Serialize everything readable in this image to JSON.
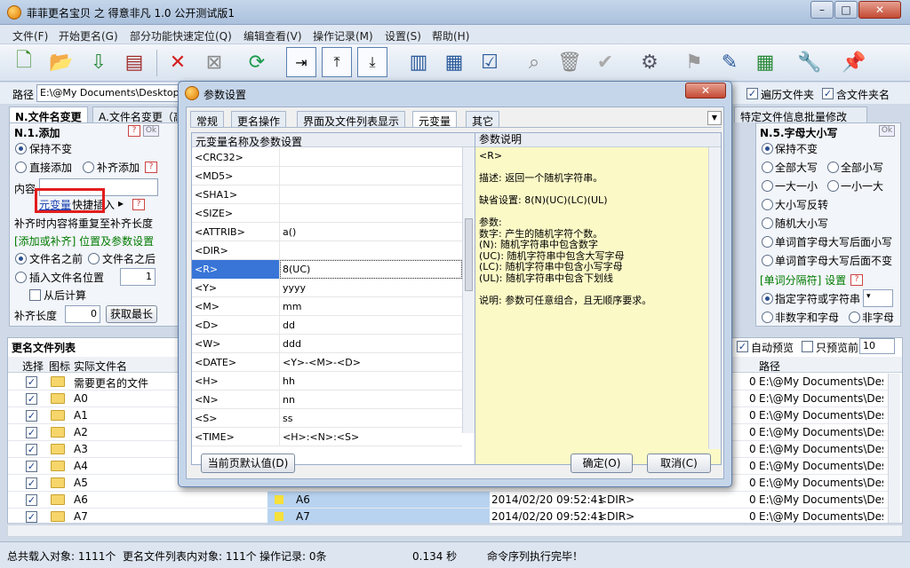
{
  "app": {
    "title": "菲菲更名宝贝 之 得意非凡 1.0 公开测试版1"
  },
  "menu": [
    "文件(F)",
    "开始更名(G)",
    "部分功能快速定位(Q)",
    "编辑查看(V)",
    "操作记录(M)",
    "设置(S)",
    "帮助(H)"
  ],
  "pathbar": {
    "label": "路径",
    "value": "E:\\@My Documents\\Desktop\\",
    "traverse_folders": "遍历文件夹",
    "include_folder_names": "含文件夹名"
  },
  "left_panel": {
    "tabs": [
      "N.文件名变更",
      "A.文件名变更（高"
    ],
    "section_title": "N.1.添加",
    "keep": "保持不变",
    "direct_add": "直接添加",
    "pad_add": "补齐添加",
    "content_label": "内容",
    "meta_link": "元变量",
    "quick_insert": "快捷插入",
    "pad_repeat_note": "补齐时内容将重复至补齐长度",
    "position_header": "[添加或补齐] 位置及参数设置",
    "before_name": "文件名之前",
    "after_name": "文件名之后",
    "insert_pos": "插入文件名位置",
    "insert_value": "1",
    "from_end": "从后计算",
    "pad_len_label": "补齐长度",
    "pad_len_value": "0",
    "get_max": "获取最长"
  },
  "right_panel": {
    "tab": "特定文件信息批量修改",
    "section_title": "N.5.字母大小写",
    "options": [
      "保持不变",
      "全部大写",
      "全部小写",
      "一大一小",
      "一小一大",
      "大小写反转",
      "随机大小写",
      "单词首字母大写后面小写",
      "单词首字母大写后面不变"
    ],
    "word_sep_header": "[单词分隔符] 设置",
    "specified": "指定字符或字符串",
    "non_digit": "非数字和字母",
    "non_letter": "非字母",
    "auto_preview": "自动预览",
    "preview_only": "只预览前",
    "preview_count": "10"
  },
  "file_list": {
    "title": "更名文件列表",
    "columns": {
      "select": "选择",
      "icon": "图标",
      "name": "实际文件名",
      "path": "路径"
    },
    "rows": [
      {
        "name": "需要更名的文件",
        "new": "",
        "time": "",
        "type": "",
        "size": "0",
        "path": "E:\\@My Documents\\Desktop"
      },
      {
        "name": "A0",
        "new": "",
        "time": "",
        "type": "",
        "size": "0",
        "path": "E:\\@My Documents\\Desktop"
      },
      {
        "name": "A1",
        "new": "",
        "time": "",
        "type": "",
        "size": "0",
        "path": "E:\\@My Documents\\Desktop"
      },
      {
        "name": "A2",
        "new": "",
        "time": "",
        "type": "",
        "size": "0",
        "path": "E:\\@My Documents\\Desktop"
      },
      {
        "name": "A3",
        "new": "",
        "time": "",
        "type": "",
        "size": "0",
        "path": "E:\\@My Documents\\Desktop"
      },
      {
        "name": "A4",
        "new": "",
        "time": "",
        "type": "",
        "size": "0",
        "path": "E:\\@My Documents\\Desktop"
      },
      {
        "name": "A5",
        "new": "",
        "time": "",
        "type": "",
        "size": "0",
        "path": "E:\\@My Documents\\Desktop"
      },
      {
        "name": "A6",
        "new": "A6",
        "time": "2014/02/20 09:52:41",
        "type": "<DIR>",
        "size": "0",
        "path": "E:\\@My Documents\\Desktop"
      },
      {
        "name": "A7",
        "new": "A7",
        "time": "2014/02/20 09:52:41",
        "type": "<DIR>",
        "size": "0",
        "path": "E:\\@My Documents\\Desktop"
      }
    ]
  },
  "status": {
    "loaded": "总共载入对象: 1111个",
    "list_count": "更名文件列表内对象: 111个",
    "ops": "操作记录: 0条",
    "elapsed": "0.134 秒",
    "message": "命令序列执行完毕！"
  },
  "dialog": {
    "title": "参数设置",
    "tabs": [
      "常规",
      "更名操作",
      "界面及文件列表显示",
      "元变量",
      "其它"
    ],
    "grid_header": "元变量名称及参数设置",
    "desc_header": "参数说明",
    "rows": [
      {
        "k": "<CRC32>",
        "v": ""
      },
      {
        "k": "<MD5>",
        "v": ""
      },
      {
        "k": "<SHA1>",
        "v": ""
      },
      {
        "k": "<SIZE>",
        "v": ""
      },
      {
        "k": "<ATTRIB>",
        "v": "a()"
      },
      {
        "k": "<DIR>",
        "v": ""
      },
      {
        "k": "<R>",
        "v": "8(UC)"
      },
      {
        "k": "<Y>",
        "v": "yyyy"
      },
      {
        "k": "<M>",
        "v": "mm"
      },
      {
        "k": "<D>",
        "v": "dd"
      },
      {
        "k": "<W>",
        "v": "ddd"
      },
      {
        "k": "<DATE>",
        "v": "<Y>-<M>-<D>"
      },
      {
        "k": "<H>",
        "v": "hh"
      },
      {
        "k": "<N>",
        "v": "nn"
      },
      {
        "k": "<S>",
        "v": "ss"
      },
      {
        "k": "<TIME>",
        "v": "<H>:<N>:<S>"
      }
    ],
    "desc_lines": [
      "<R>",
      "",
      "描述: 返回一个随机字符串。",
      "",
      "缺省设置: 8(N)(UC)(LC)(UL)",
      "",
      "参数:",
      "数字: 产生的随机字符个数。",
      "(N): 随机字符串中包含数字",
      "(UC): 随机字符串中包含大写字母",
      "(LC): 随机字符串中包含小写字母",
      "(UL): 随机字符串中包含下划线",
      "",
      "说明: 参数可任意组合，且无顺序要求。"
    ],
    "btn_default": "当前页默认值(D)",
    "btn_ok": "确定(O)",
    "btn_cancel": "取消(C)"
  }
}
